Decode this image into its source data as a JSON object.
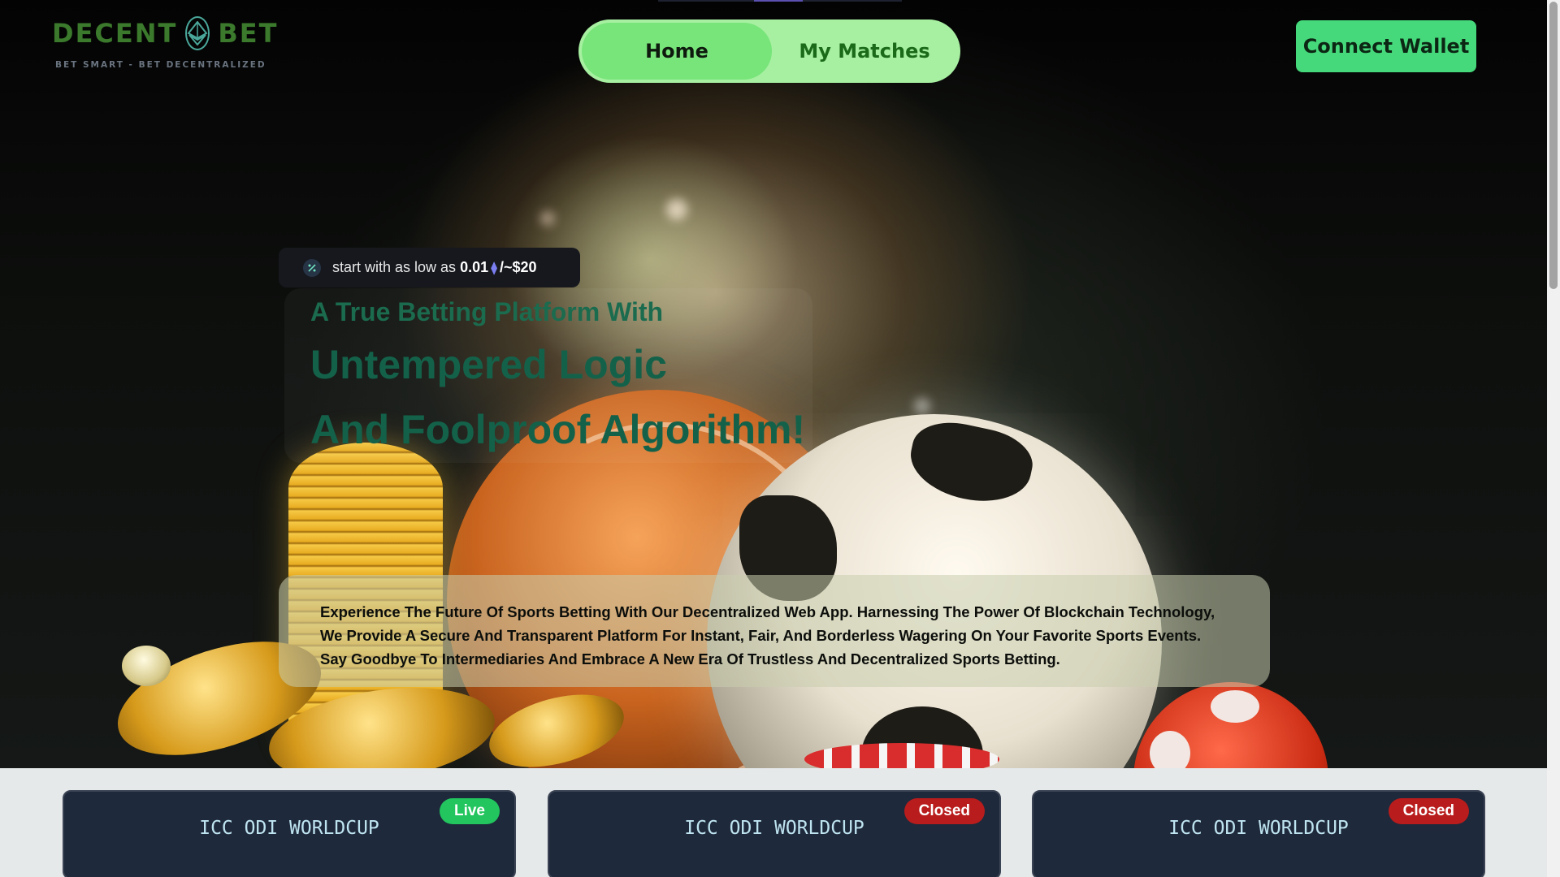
{
  "header": {
    "logo_left": "DECENT",
    "logo_right": "BET",
    "tagline": "BET SMART - BET DECENTRALIZED",
    "nav": {
      "home": "Home",
      "my_matches": "My Matches",
      "active": "Home"
    },
    "connect_wallet": "Connect Wallet"
  },
  "hero": {
    "pill": {
      "prefix": "start with as low as",
      "amount": "0.01",
      "eth_symbol": "⧫",
      "suffix": "/~$20"
    },
    "headline_small": "A True Betting Platform With",
    "headline_line1": "Untempered Logic",
    "headline_line2": "And Foolproof Algorithm!",
    "description": "Experience The Future Of Sports Betting With Our Decentralized Web App. Harnessing The Power Of Blockchain Technology, We Provide A Secure And Transparent Platform For Instant, Fair, And Borderless Wagering On Your Favorite Sports Events. Say Goodbye To Intermediaries And Embrace A New Era Of Trustless And Decentralized Sports Betting."
  },
  "matches": [
    {
      "title": "ICC ODI WORLDCUP",
      "status": "Live"
    },
    {
      "title": "ICC ODI WORLDCUP",
      "status": "Closed"
    },
    {
      "title": "ICC ODI WORLDCUP",
      "status": "Closed"
    }
  ],
  "colors": {
    "brand_green": "#45d97b",
    "nav_bg": "#a7f0a1",
    "nav_active": "#77e57a",
    "card_bg": "#1e293b",
    "live": "#22c55e",
    "closed": "#b91c1c",
    "headline": "#14614a"
  },
  "icons": {
    "logo": "ethereum-coin-icon",
    "pill": "percent-icon",
    "eth": "ethereum-icon"
  }
}
